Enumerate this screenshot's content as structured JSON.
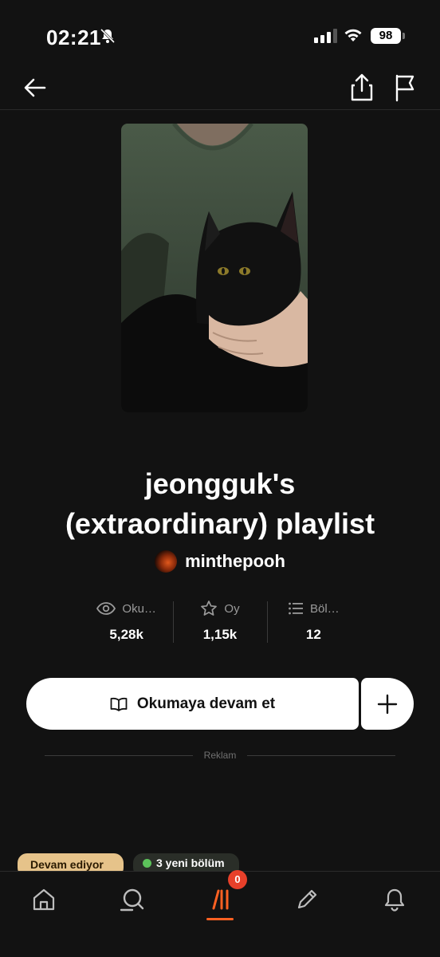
{
  "status_bar": {
    "time": "02:21",
    "battery": "98"
  },
  "story": {
    "title_line1": "jeongguk's",
    "title_line2": "(extraordinary) playlist",
    "author": "minthepooh"
  },
  "stats": [
    {
      "icon": "eye-icon",
      "label": "Oku…",
      "value": "5,28k"
    },
    {
      "icon": "star-icon",
      "label": "Oy",
      "value": "1,15k"
    },
    {
      "icon": "list-icon",
      "label": "Böl…",
      "value": "12"
    }
  ],
  "actions": {
    "read_label": "Okumaya devam et",
    "add_symbol": "+"
  },
  "ad": {
    "label": "Reklam"
  },
  "tags": {
    "status": "Devam ediyor",
    "new_parts": "3 yeni bölüm"
  },
  "tab_bar": {
    "items": [
      "home-icon",
      "search-icon",
      "library-icon",
      "pencil-icon",
      "bell-icon"
    ],
    "library_badge": "0"
  },
  "colors": {
    "accent": "#ff6122",
    "badge": "#e8402a",
    "ongoing_tag": "#e6c38a",
    "new_dot": "#5cc25a",
    "background": "#121212"
  }
}
